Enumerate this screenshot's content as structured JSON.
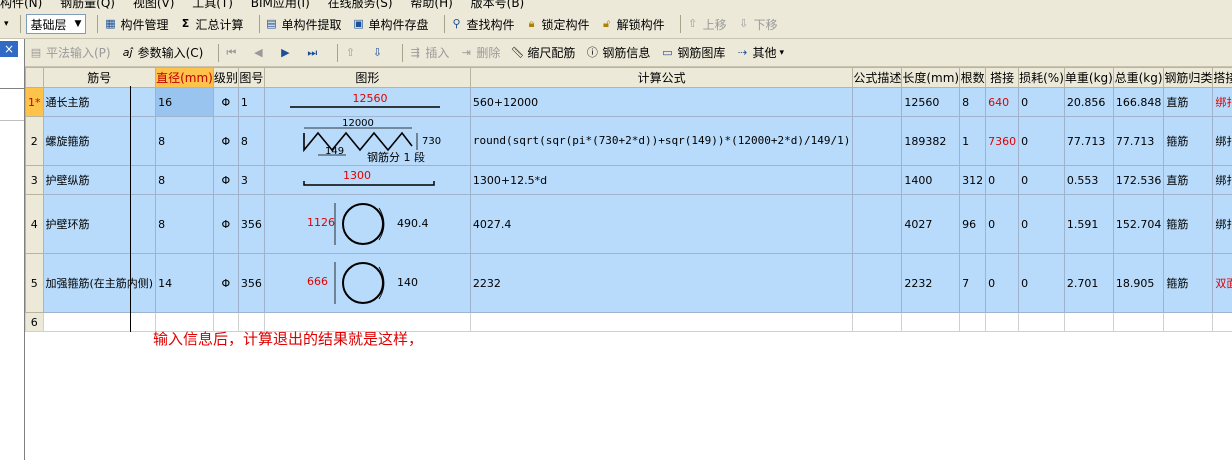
{
  "menu": [
    "构件(N)",
    "钢筋量(Q)",
    "视图(V)",
    "工具(T)",
    "BIM应用(I)",
    "在线服务(S)",
    "帮助(H)",
    "版本号(B)"
  ],
  "toolbar1": {
    "layer": "基础层",
    "items": [
      "构件管理",
      "汇总计算",
      "单构件提取",
      "单构件存盘",
      "查找构件",
      "锁定构件",
      "解锁构件",
      "上移",
      "下移"
    ]
  },
  "toolbar2": {
    "items": [
      "平法输入(P)",
      "参数输入(C)",
      "插入",
      "删除",
      "缩尺配筋",
      "钢筋信息",
      "钢筋图库",
      "其他"
    ]
  },
  "close_label": "×",
  "table": {
    "headers": [
      "筋号",
      "直径(mm)",
      "级别",
      "图号",
      "图形",
      "计算公式",
      "公式描述",
      "长度(mm)",
      "根数",
      "搭接",
      "损耗(%)",
      "单重(kg)",
      "总重(kg)",
      "钢筋归类",
      "搭接形式"
    ],
    "rows": [
      {
        "num": "1*",
        "name": "通长主筋",
        "dia": "16",
        "grade": "Φ",
        "fig": "1",
        "shape": {
          "len": "12560"
        },
        "formula": "560+12000",
        "desc": "",
        "length": "12560",
        "count": "8",
        "lap": "640",
        "loss": "0",
        "unit_w": "20.856",
        "total_w": "166.848",
        "type": "直筋",
        "conn": "绑扎"
      },
      {
        "num": "2",
        "name": "螺旋箍筋",
        "dia": "8",
        "grade": "Φ",
        "fig": "8",
        "shape": {
          "top": "12000",
          "side": "730",
          "pitch": "149",
          "note": "钢筋分 1 段"
        },
        "formula": "round(sqrt(sqr(pi*(730+2*d))+sqr(149))*(12000+2*d)/149/1)",
        "desc": "",
        "length": "189382",
        "count": "1",
        "lap": "7360",
        "loss": "0",
        "unit_w": "77.713",
        "total_w": "77.713",
        "type": "箍筋",
        "conn": "绑扎"
      },
      {
        "num": "3",
        "name": "护壁纵筋",
        "dia": "8",
        "grade": "Φ",
        "fig": "3",
        "shape": {
          "len": "1300"
        },
        "formula": "1300+12.5*d",
        "desc": "",
        "length": "1400",
        "count": "312",
        "lap": "0",
        "loss": "0",
        "unit_w": "0.553",
        "total_w": "172.536",
        "type": "直筋",
        "conn": "绑扎"
      },
      {
        "num": "4",
        "name": "护壁环筋",
        "dia": "8",
        "grade": "Φ",
        "fig": "356",
        "shape": {
          "dia": "1126",
          "lap": "490.4"
        },
        "formula": "4027.4",
        "desc": "",
        "length": "4027",
        "count": "96",
        "lap": "0",
        "loss": "0",
        "unit_w": "1.591",
        "total_w": "152.704",
        "type": "箍筋",
        "conn": "绑扎"
      },
      {
        "num": "5",
        "name": "加强箍筋(在主筋内侧)",
        "dia": "14",
        "grade": "Φ",
        "fig": "356",
        "shape": {
          "dia": "666",
          "lap": "140"
        },
        "formula": "2232",
        "desc": "",
        "length": "2232",
        "count": "7",
        "lap": "0",
        "loss": "0",
        "unit_w": "2.701",
        "total_w": "18.905",
        "type": "箍筋",
        "conn": "双面焊"
      },
      {
        "num": "6"
      }
    ]
  },
  "note": "输入信息后，计算退出的结果就是这样，",
  "colors": {
    "red": "#e00000",
    "row_bg": "#b8dbfb",
    "header_sel": "#ffc24a",
    "toolbar": "#ece9d8"
  }
}
